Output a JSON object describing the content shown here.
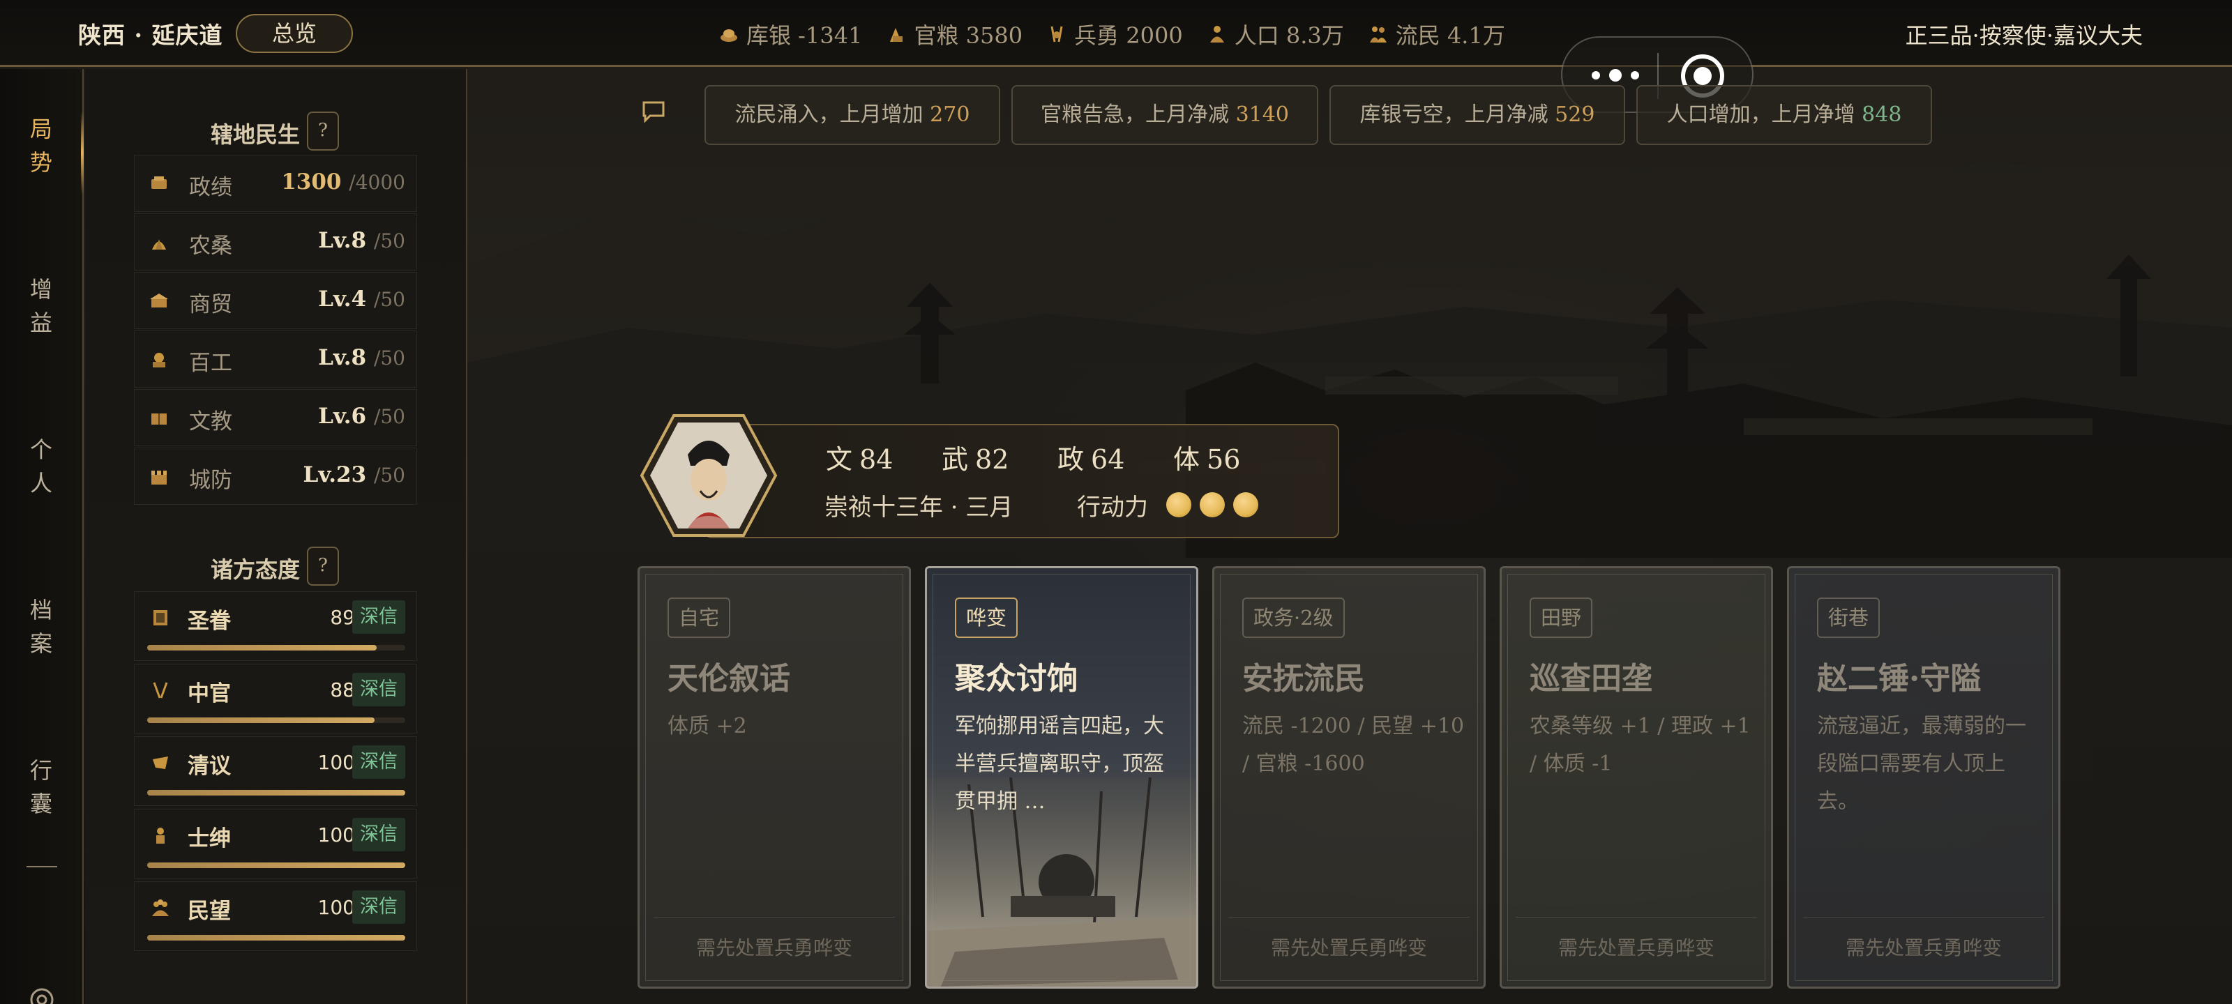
{
  "topbar": {
    "region": "陕西 · 延庆道",
    "overview_button": "总览",
    "resources": [
      {
        "icon": "silver-icon",
        "label": "库银 -1341"
      },
      {
        "icon": "grain-icon",
        "label": "官粮 3580"
      },
      {
        "icon": "soldier-icon",
        "label": "兵勇 2000"
      },
      {
        "icon": "population-icon",
        "label": "人口 8.3万"
      },
      {
        "icon": "refugee-icon",
        "label": "流民 4.1万"
      }
    ],
    "rank": "正三品·按察使·嘉议大夫"
  },
  "nav": {
    "items": [
      {
        "l1": "局",
        "l2": "势"
      },
      {
        "l1": "增",
        "l2": "益"
      },
      {
        "l1": "个",
        "l2": "人"
      },
      {
        "l1": "档",
        "l2": "案"
      },
      {
        "l1": "行",
        "l2": "囊"
      }
    ]
  },
  "governance": {
    "title": "辖地民生",
    "help": "?",
    "stats": [
      {
        "name": "政绩",
        "value": "1300",
        "max": "/4000"
      },
      {
        "name": "农桑",
        "value": "Lv.8",
        "max": "/50"
      },
      {
        "name": "商贸",
        "value": "Lv.4",
        "max": "/50"
      },
      {
        "name": "百工",
        "value": "Lv.8",
        "max": "/50"
      },
      {
        "name": "文教",
        "value": "Lv.6",
        "max": "/50"
      },
      {
        "name": "城防",
        "value": "Lv.23",
        "max": "/50"
      }
    ]
  },
  "attitudes": {
    "title": "诸方态度",
    "help": "?",
    "items": [
      {
        "name": "圣眷",
        "value": "89",
        "badge": "深信",
        "fill": 0.89
      },
      {
        "name": "中官",
        "value": "88",
        "badge": "深信",
        "fill": 0.88
      },
      {
        "name": "清议",
        "value": "100",
        "badge": "深信",
        "fill": 1.0
      },
      {
        "name": "士绅",
        "value": "100",
        "badge": "深信",
        "fill": 1.0
      },
      {
        "name": "民望",
        "value": "100",
        "badge": "深信",
        "fill": 1.0
      }
    ]
  },
  "news": [
    {
      "text": "流民涌入，上月增加 ",
      "num": "270"
    },
    {
      "text": "官粮告急，上月净减 ",
      "num": "3140"
    },
    {
      "text": "库银亏空，上月净减 ",
      "num": "529"
    },
    {
      "text": "人口增加，上月净增 ",
      "num": "848"
    }
  ],
  "hero": {
    "attrs": [
      {
        "k": "文",
        "v": "84"
      },
      {
        "k": "武",
        "v": "82"
      },
      {
        "k": "政",
        "v": "64"
      },
      {
        "k": "体",
        "v": "56"
      }
    ],
    "date": "崇祯十三年 · 三月",
    "action_label": "行动力",
    "action_points": 3
  },
  "cards": [
    {
      "tag": "自宅",
      "title": "天伦叙话",
      "desc": "体质 +2",
      "foot": "需先处置兵勇哗变"
    },
    {
      "tag": "哗变",
      "title": "聚众讨饷",
      "desc": "军饷挪用谣言四起，大半营兵擅离职守，顶盔贯甲拥 …",
      "foot": ""
    },
    {
      "tag": "政务·2级",
      "title": "安抚流民",
      "desc": "流民 -1200 / 民望 +10 / 官粮 -1600",
      "foot": "需先处置兵勇哗变"
    },
    {
      "tag": "田野",
      "title": "巡查田垄",
      "desc": "农桑等级 +1 / 理政 +1 / 体质 -1",
      "foot": "需先处置兵勇哗变"
    },
    {
      "tag": "街巷",
      "title": "赵二锤·守隘",
      "desc": "流寇逼近，最薄弱的一段隘口需要有人顶上去。",
      "foot": "需先处置兵勇哗变"
    }
  ]
}
